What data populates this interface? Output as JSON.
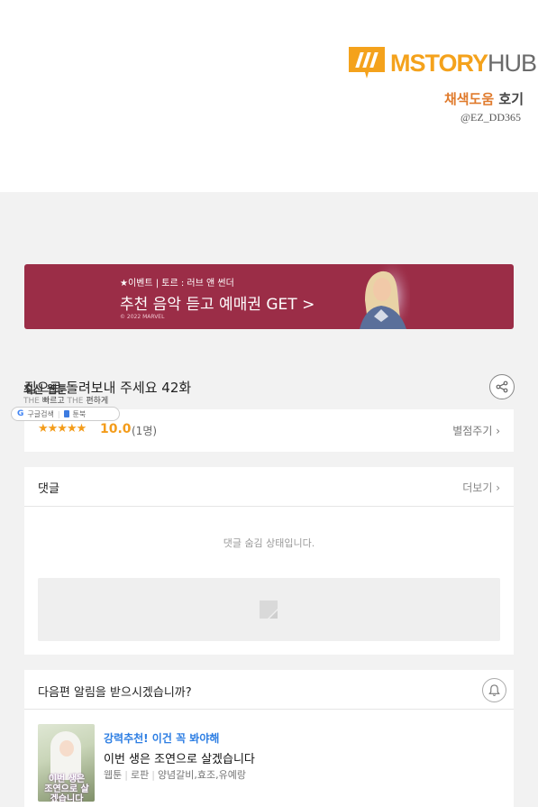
{
  "header_image": {
    "logo_text_primary": "MSTORY",
    "logo_text_secondary": "HUB",
    "credit_line_1_a": "채색도움",
    "credit_line_1_b": "호기",
    "credit_line_2": "@EZ_DD365"
  },
  "banner": {
    "small_text": "★이벤트 | 토르 : 러브 앤 썬더",
    "main_text": "추천 음악 듣고 예매권 GET >",
    "copyright": "© 2022 MARVEL"
  },
  "episode": {
    "title": "집으로 돌려보내 주세요 42화"
  },
  "overlay": {
    "label": "최신 웹툰",
    "tagline_1": "THE",
    "tagline_2": "빠르고",
    "tagline_3": "THE",
    "tagline_4": "편하게",
    "google_label": "구글검색",
    "book_label": "툰북"
  },
  "rating": {
    "stars": "★★★★★",
    "score": "10.0",
    "count": "(1명)",
    "rate_button": "별점주기 ›"
  },
  "comments": {
    "title": "댓글",
    "more": "더보기 ›",
    "hidden_message": "댓글 숨김 상태입니다."
  },
  "notify": {
    "question": "다음편 알림을 받으시겠습니까?"
  },
  "recommend": {
    "badge": "강력추천! 이건 꼭 봐야해",
    "title": "이번 생은 조연으로 살겠습니다",
    "meta_type": "웹툰",
    "meta_genre": "로판",
    "meta_authors": "양념갈비,효조,유예랑",
    "thumb_text": "이번 생은 조연으로 살겠습니다"
  },
  "colors": {
    "accent_orange": "#f39c1b",
    "banner_bg": "#9b2d47",
    "link_blue": "#2d7ee3"
  }
}
